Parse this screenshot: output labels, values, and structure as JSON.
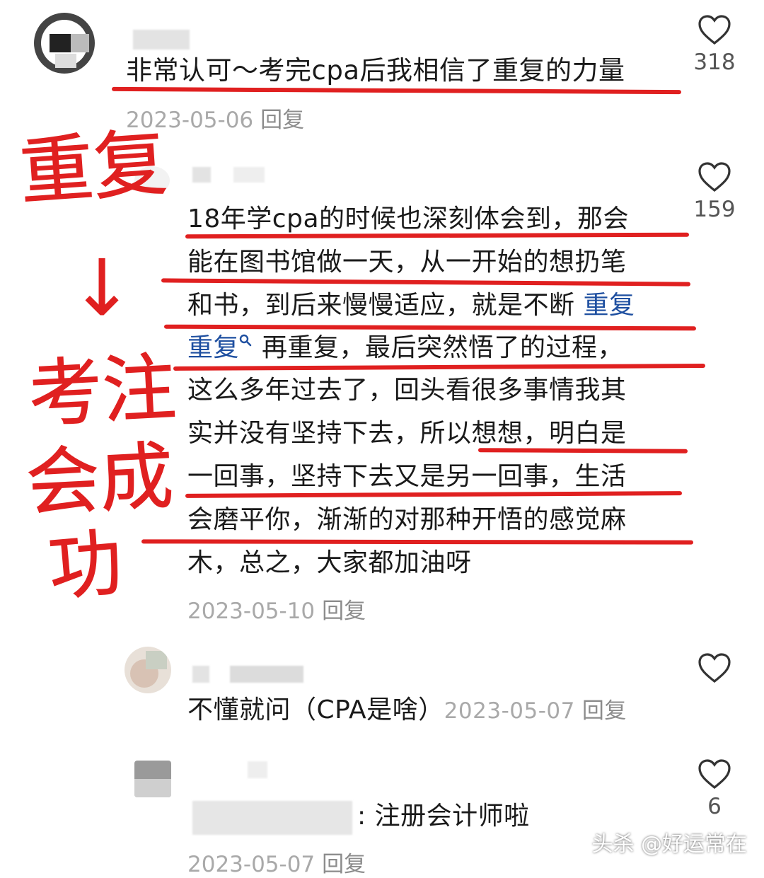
{
  "comments": [
    {
      "text": "非常认可～考完cpa后我相信了重复的力量",
      "date": "2023-05-06",
      "reply": "回复",
      "likes": "318"
    },
    {
      "lines": [
        "18年学cpa的时候也深刻体会到，那会",
        "能在图书馆做一天，从一开始的想扔笔",
        "和书，到后来慢慢适应，就是不断 ",
        "再重复，最后突然悟了的过程，",
        "这么多年过去了，回头看很多事情我其",
        "实并没有坚持下去，所以想想，明白是",
        "一回事，坚持下去又是另一回事，生活",
        "会磨平你，渐渐的对那种开悟的感觉麻",
        "木，总之，大家都加油呀"
      ],
      "link_part1": "重复",
      "link_part2": "重复",
      "date": "2023-05-10",
      "reply": "回复",
      "likes": "159"
    },
    {
      "text": "不懂就问（CPA是啥）",
      "date": "2023-05-07",
      "reply": "回复",
      "likes": ""
    },
    {
      "text": ": 注册会计师啦",
      "date": "2023-05-07",
      "reply": "回复",
      "likes": "6"
    }
  ],
  "handwriting": [
    "重复",
    "↓",
    "考注",
    "会成",
    "功"
  ],
  "watermark": "头杀 @好运常在",
  "colors": {
    "accent_red": "#e02020",
    "link_blue": "#1e4fa0"
  },
  "icons": [
    "heart-outline-icon",
    "search-icon"
  ]
}
